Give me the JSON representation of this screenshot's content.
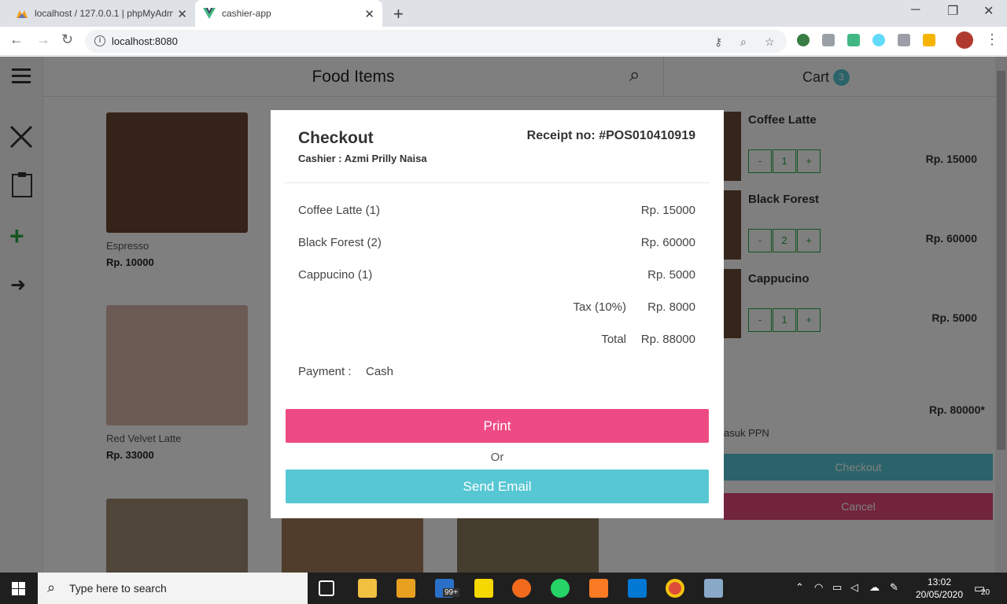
{
  "browser": {
    "tabs": [
      {
        "title": "localhost / 127.0.0.1 | phpMyAdm"
      },
      {
        "title": "cashier-app"
      }
    ],
    "url": "localhost:8080"
  },
  "app": {
    "food_header": "Food Items",
    "cart_header": "Cart",
    "cart_count": "3",
    "foods": [
      {
        "name": "Espresso",
        "price": "Rp. 10000"
      },
      {
        "name": "Red Velvet Latte",
        "price": "Rp. 33000"
      }
    ],
    "cart_items": [
      {
        "name": "Coffee Latte",
        "qty": "1",
        "price": "Rp. 15000"
      },
      {
        "name": "Black Forest",
        "qty": "2",
        "price": "Rp. 60000"
      },
      {
        "name": "Cappucino",
        "qty": "1",
        "price": "Rp. 5000"
      }
    ],
    "cart_total": "Rp. 80000*",
    "cart_note": "asuk PPN",
    "checkout_label": "Checkout",
    "cancel_label": "Cancel",
    "minus_label": "-",
    "plus_label": "+"
  },
  "modal": {
    "title": "Checkout",
    "cashier_label": "Cashier :",
    "cashier_name": "Azmi Prilly Naisa",
    "receipt_label": "Receipt no:",
    "receipt_no": "#POS010410919",
    "items": [
      {
        "label": "Coffee Latte (1)",
        "price": "Rp. 15000"
      },
      {
        "label": "Black Forest (2)",
        "price": "Rp. 60000"
      },
      {
        "label": "Cappucino (1)",
        "price": "Rp. 5000"
      }
    ],
    "tax_label": "Tax (10%)",
    "tax_value": "Rp. 8000",
    "total_label": "Total",
    "total_value": "Rp. 88000",
    "payment_label": "Payment :",
    "payment_value": "Cash",
    "print_label": "Print",
    "or_label": "Or",
    "email_label": "Send Email"
  },
  "taskbar": {
    "search_placeholder": "Type here to search",
    "time": "13:02",
    "date": "20/05/2020",
    "mail_badge": "99+",
    "notif_count": "20"
  },
  "colors": {
    "accent_pink": "#ee4b84",
    "accent_teal": "#57c7d4",
    "qty_green": "#28a745"
  }
}
